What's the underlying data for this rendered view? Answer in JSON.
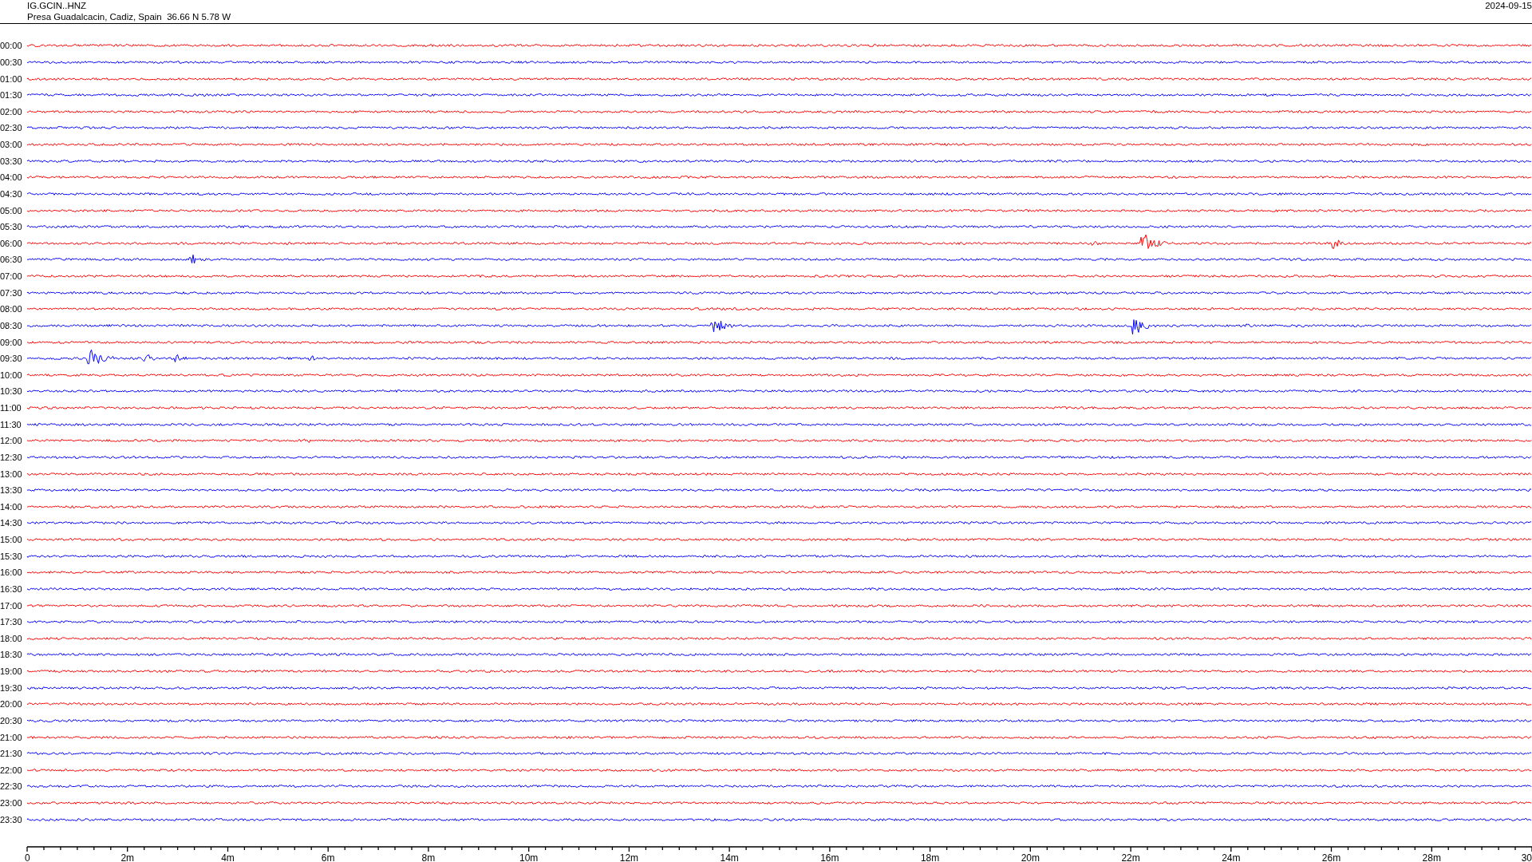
{
  "header": {
    "channel": "IG.GCIN..HNZ",
    "station": "Presa Guadalcacin, Cadiz, Spain  36.66 N 5.78 W",
    "date": "2024-09-15"
  },
  "traces": [
    {
      "time": "00:00",
      "color": "#ff0000"
    },
    {
      "time": "00:30",
      "color": "#0000ff"
    },
    {
      "time": "01:00",
      "color": "#ff0000"
    },
    {
      "time": "01:30",
      "color": "#0000ff"
    },
    {
      "time": "02:00",
      "color": "#ff0000"
    },
    {
      "time": "02:30",
      "color": "#0000ff"
    },
    {
      "time": "03:00",
      "color": "#ff0000"
    },
    {
      "time": "03:30",
      "color": "#0000ff"
    },
    {
      "time": "04:00",
      "color": "#ff0000"
    },
    {
      "time": "04:30",
      "color": "#0000ff"
    },
    {
      "time": "05:00",
      "color": "#ff0000"
    },
    {
      "time": "05:30",
      "color": "#0000ff"
    },
    {
      "time": "06:00",
      "color": "#ff0000"
    },
    {
      "time": "06:30",
      "color": "#0000ff"
    },
    {
      "time": "07:00",
      "color": "#ff0000"
    },
    {
      "time": "07:30",
      "color": "#0000ff"
    },
    {
      "time": "08:00",
      "color": "#ff0000"
    },
    {
      "time": "08:30",
      "color": "#0000ff"
    },
    {
      "time": "09:00",
      "color": "#ff0000"
    },
    {
      "time": "09:30",
      "color": "#0000ff"
    },
    {
      "time": "10:00",
      "color": "#ff0000"
    },
    {
      "time": "10:30",
      "color": "#0000ff"
    },
    {
      "time": "11:00",
      "color": "#ff0000"
    },
    {
      "time": "11:30",
      "color": "#0000ff"
    },
    {
      "time": "12:00",
      "color": "#ff0000"
    },
    {
      "time": "12:30",
      "color": "#0000ff"
    },
    {
      "time": "13:00",
      "color": "#ff0000"
    },
    {
      "time": "13:30",
      "color": "#0000ff"
    },
    {
      "time": "14:00",
      "color": "#ff0000"
    },
    {
      "time": "14:30",
      "color": "#0000ff"
    },
    {
      "time": "15:00",
      "color": "#ff0000"
    },
    {
      "time": "15:30",
      "color": "#0000ff"
    },
    {
      "time": "16:00",
      "color": "#ff0000"
    },
    {
      "time": "16:30",
      "color": "#0000ff"
    },
    {
      "time": "17:00",
      "color": "#ff0000"
    },
    {
      "time": "17:30",
      "color": "#0000ff"
    },
    {
      "time": "18:00",
      "color": "#ff0000"
    },
    {
      "time": "18:30",
      "color": "#0000ff"
    },
    {
      "time": "19:00",
      "color": "#ff0000"
    },
    {
      "time": "19:30",
      "color": "#0000ff"
    },
    {
      "time": "20:00",
      "color": "#ff0000"
    },
    {
      "time": "20:30",
      "color": "#0000ff"
    },
    {
      "time": "21:00",
      "color": "#ff0000"
    },
    {
      "time": "21:30",
      "color": "#0000ff"
    },
    {
      "time": "22:00",
      "color": "#ff0000"
    },
    {
      "time": "22:30",
      "color": "#0000ff"
    },
    {
      "time": "23:00",
      "color": "#ff0000"
    },
    {
      "time": "23:30",
      "color": "#0000ff"
    }
  ],
  "x_axis": {
    "labels": [
      "0",
      "2m",
      "4m",
      "6m",
      "8m",
      "10m",
      "12m",
      "14m",
      "16m",
      "18m",
      "20m",
      "22m",
      "24m",
      "26m",
      "28m",
      "30"
    ]
  }
}
